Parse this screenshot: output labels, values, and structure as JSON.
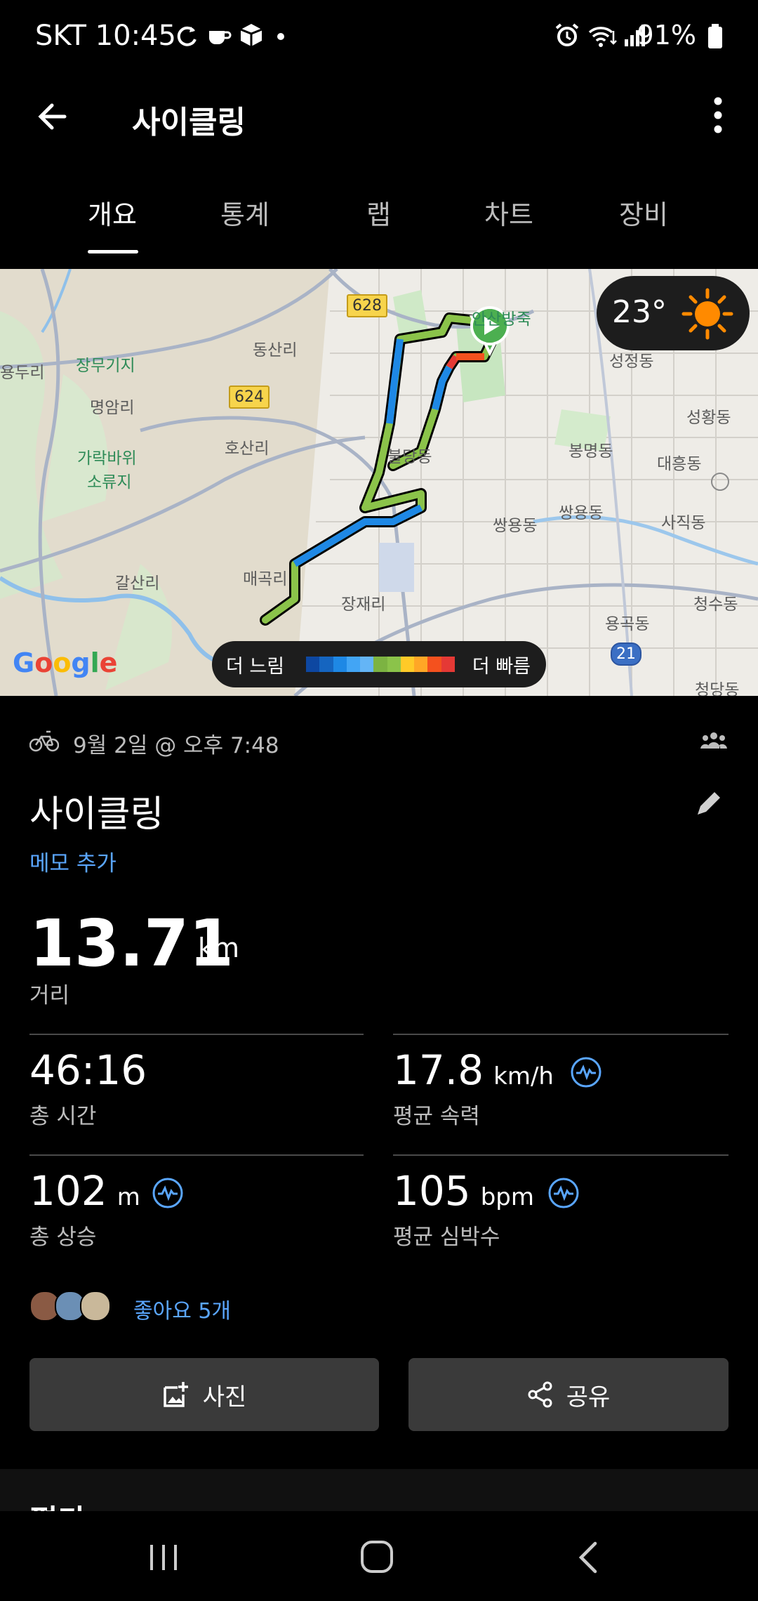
{
  "status_bar": {
    "carrier_time": "SKT 10:45",
    "battery": "91%"
  },
  "app_bar": {
    "title": "사이클링"
  },
  "tabs": [
    {
      "label": "개요"
    },
    {
      "label": "통계"
    },
    {
      "label": "랩"
    },
    {
      "label": "차트"
    },
    {
      "label": "장비"
    }
  ],
  "map": {
    "weather_temp": "23°",
    "legend_slow": "더 느림",
    "legend_fast": "더 빠름",
    "legend_colors": [
      "#0d47a1",
      "#1565c0",
      "#1e88e5",
      "#42a5f5",
      "#64b5f6",
      "#7cb342",
      "#8bc34a",
      "#ffca28",
      "#ffa726",
      "#f4511e",
      "#e53935"
    ],
    "route_color_primary": "#8bc34a",
    "route_color_secondary": "#1e88e5",
    "google": "Google",
    "labels": {
      "yongduri": "용두리",
      "jangmugiji": "장무기지",
      "myeongamri": "명암리",
      "garakbawi1": "가락바위",
      "garakbawi2": "소류지",
      "dongsanri": "동산리",
      "hosanri": "호산리",
      "galsanri": "갈산리",
      "maegokri": "매곡리",
      "jangjaeri": "장재리",
      "buldangdong": "불당동",
      "ansabang": "안산방죽",
      "seongjeongdong": "성정동",
      "seonghwangdong": "성황동",
      "bongmyeongdong": "봉명동",
      "daeheungdong": "대흥동",
      "ssangyongdong1": "쌍용동",
      "ssangyongdong2": "쌍용동",
      "sajikdong": "사직동",
      "cheongsudong": "청수동",
      "yonggokdong": "용곡동",
      "cheongdangdong": "청당동"
    },
    "road_signs": {
      "r628": "628",
      "r624": "624",
      "r21": "21"
    }
  },
  "activity": {
    "date": "9월 2일 @ 오후 7:48",
    "name": "사이클링",
    "memo": "메모 추가",
    "distance": {
      "value": "13.71",
      "unit": "km",
      "label": "거리"
    },
    "stats": [
      {
        "value": "46:16",
        "unit": "",
        "label": "총 시간"
      },
      {
        "value": "17.8",
        "unit": "km/h",
        "label": "평균 속력"
      },
      {
        "value": "102",
        "unit": "m",
        "label": "총 상승"
      },
      {
        "value": "105",
        "unit": "bpm",
        "label": "평균 심박수"
      }
    ],
    "likes": "좋아요 5개",
    "photo_button": "사진",
    "share_button": "공유",
    "next_section_peek": "평가"
  }
}
